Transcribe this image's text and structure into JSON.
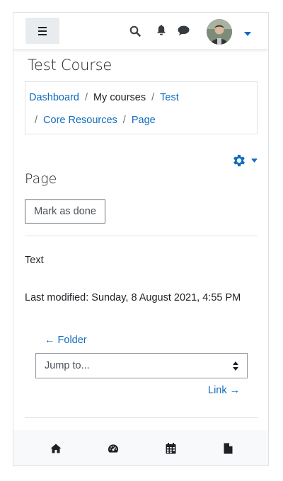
{
  "course": {
    "title": "Test Course"
  },
  "breadcrumb": {
    "items": [
      {
        "label": "Dashboard"
      },
      {
        "label": "My courses"
      },
      {
        "label": "Test"
      },
      {
        "label": "Core Resources"
      },
      {
        "label": "Page"
      }
    ],
    "separator": "/"
  },
  "activity": {
    "heading": "Page",
    "mark_done_label": "Mark as done",
    "content_text": "Text",
    "last_modified": "Last modified: Sunday, 8 August 2021, 4:55 PM"
  },
  "navigation": {
    "prev_label": "← Folder",
    "jump_label": "Jump to...",
    "next_label": "Link →"
  },
  "colors": {
    "link": "#0f6cbf",
    "text": "#1d2125",
    "footer_bg": "#f8f9fa",
    "hamburger_bg": "#e9ecef"
  },
  "icons": {
    "nav": [
      "menu-icon",
      "search-icon",
      "bell-icon",
      "chat-icon",
      "avatar",
      "chevron-down-icon"
    ],
    "footer": [
      "home-icon",
      "dashboard-icon",
      "calendar-icon",
      "file-icon"
    ]
  }
}
